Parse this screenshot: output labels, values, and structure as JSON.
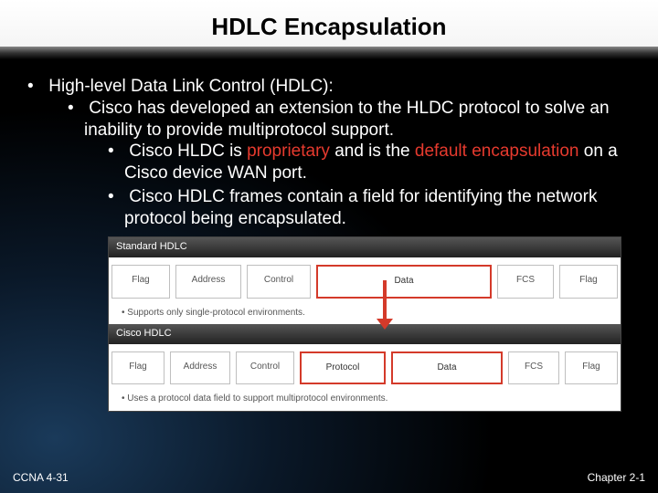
{
  "title": "HDLC Encapsulation",
  "bullets": {
    "b1": "High-level Data Link Control (HDLC):",
    "b1_1": "Cisco has developed an extension to the HLDC protocol to solve an inability to provide multiprotocol support.",
    "b1_1_1_pre": "Cisco HLDC is ",
    "b1_1_1_hl1": "proprietary",
    "b1_1_1_mid": " and is the ",
    "b1_1_1_hl2": "default encapsulation",
    "b1_1_1_post": " on a Cisco device WAN port.",
    "b1_1_2": "Cisco HDLC frames contain a field for identifying the network protocol being encapsulated."
  },
  "figure": {
    "std_header": "Standard HDLC",
    "cisco_header": "Cisco HDLC",
    "fields": {
      "flag": "Flag",
      "address": "Address",
      "control": "Control",
      "data": "Data",
      "fcs": "FCS",
      "protocol": "Protocol"
    },
    "note1": "Supports only single-protocol environments.",
    "note2": "Uses a protocol data field to support multiprotocol environments."
  },
  "footer": {
    "left": "CCNA 4-31",
    "right": "Chapter 2-1"
  }
}
